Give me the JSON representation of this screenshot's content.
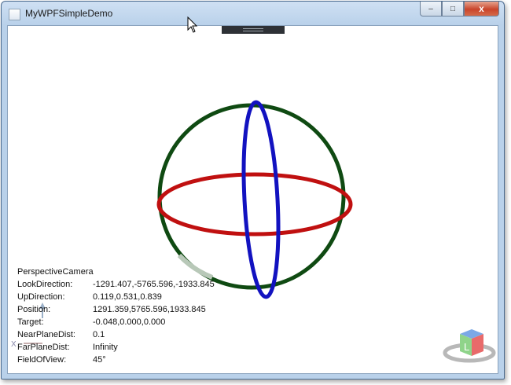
{
  "window": {
    "title": "MyWPFSimpleDemo"
  },
  "caption_buttons": {
    "minimize": "–",
    "maximize": "□",
    "close": "x"
  },
  "camera_info": {
    "header": "PerspectiveCamera",
    "rows": [
      {
        "label": "LookDirection:",
        "value": "-1291.407,-5765.596,-1933.845"
      },
      {
        "label": "UpDirection:",
        "value": "0.119,0.531,0.839"
      },
      {
        "label": "Position:",
        "value": "1291.359,5765.596,1933.845"
      },
      {
        "label": "Target:",
        "value": "-0.048,0.000,0.000"
      },
      {
        "label": "NearPlaneDist:",
        "value": "0.1"
      },
      {
        "label": "FarPlaneDist:",
        "value": "Infinity"
      },
      {
        "label": "FieldOfView:",
        "value": "45°"
      }
    ]
  },
  "view_cube": {
    "face_label": "L"
  },
  "axis_gizmo": {
    "x_label": "X"
  },
  "colors": {
    "ring_green": "#0f4a12",
    "ring_red": "#c01010",
    "ring_blue": "#1212c0"
  }
}
